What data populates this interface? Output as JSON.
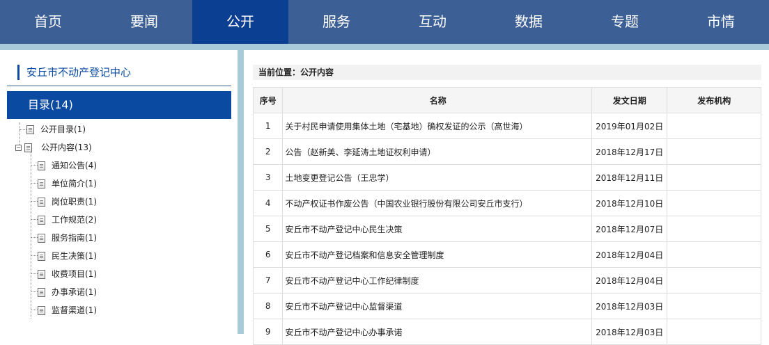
{
  "nav": {
    "items": [
      {
        "label": "首页"
      },
      {
        "label": "要闻"
      },
      {
        "label": "公开"
      },
      {
        "label": "服务"
      },
      {
        "label": "互动"
      },
      {
        "label": "数据"
      },
      {
        "label": "专题"
      },
      {
        "label": "市情"
      }
    ],
    "active_index": 2,
    "colors": {
      "bar": "#3c5f95",
      "active": "#0a3f92"
    }
  },
  "sidebar": {
    "org_title": "安丘市不动产登记中心",
    "catalog_label": "目录(14)",
    "tree": [
      {
        "label": "公开目录(1)",
        "icon": "document-icon"
      },
      {
        "label": "公开内容(13)",
        "icon": "document-icon",
        "expanded": true,
        "toggle_icon": "minus-icon"
      },
      {
        "label": "通知公告(4)",
        "icon": "document-icon"
      },
      {
        "label": "单位简介(1)",
        "icon": "document-icon"
      },
      {
        "label": "岗位职责(1)",
        "icon": "document-icon"
      },
      {
        "label": "工作规范(2)",
        "icon": "document-icon"
      },
      {
        "label": "服务指南(1)",
        "icon": "document-icon"
      },
      {
        "label": "民生决策(1)",
        "icon": "document-icon"
      },
      {
        "label": "收费项目(1)",
        "icon": "document-icon"
      },
      {
        "label": "办事承诺(1)",
        "icon": "document-icon"
      },
      {
        "label": "监督渠道(1)",
        "icon": "document-icon"
      }
    ]
  },
  "main": {
    "breadcrumb": "当前位置：公开内容",
    "table": {
      "headers": [
        "序号",
        "名称",
        "发文日期",
        "发布机构"
      ],
      "rows": [
        [
          "1",
          "关于村民申请使用集体土地（宅基地）确权发证的公示（高世海）",
          "2019年01月02日",
          ""
        ],
        [
          "2",
          "公告（赵新美、李延涛土地证权利申请）",
          "2018年12月17日",
          ""
        ],
        [
          "3",
          "土地变更登记公告（王忠学）",
          "2018年12月11日",
          ""
        ],
        [
          "4",
          "不动产权证书作废公告（中国农业银行股份有限公司安丘市支行）",
          "2018年12月10日",
          ""
        ],
        [
          "5",
          "安丘市不动产登记中心民生决策",
          "2018年12月07日",
          ""
        ],
        [
          "6",
          "安丘市不动产登记档案和信息安全管理制度",
          "2018年12月04日",
          ""
        ],
        [
          "7",
          "安丘市不动产登记中心工作纪律制度",
          "2018年12月04日",
          ""
        ],
        [
          "8",
          "安丘市不动产登记中心监督渠道",
          "2018年12月03日",
          ""
        ],
        [
          "9",
          "安丘市不动产登记中心办事承诺",
          "2018年12月03日",
          ""
        ]
      ]
    }
  }
}
